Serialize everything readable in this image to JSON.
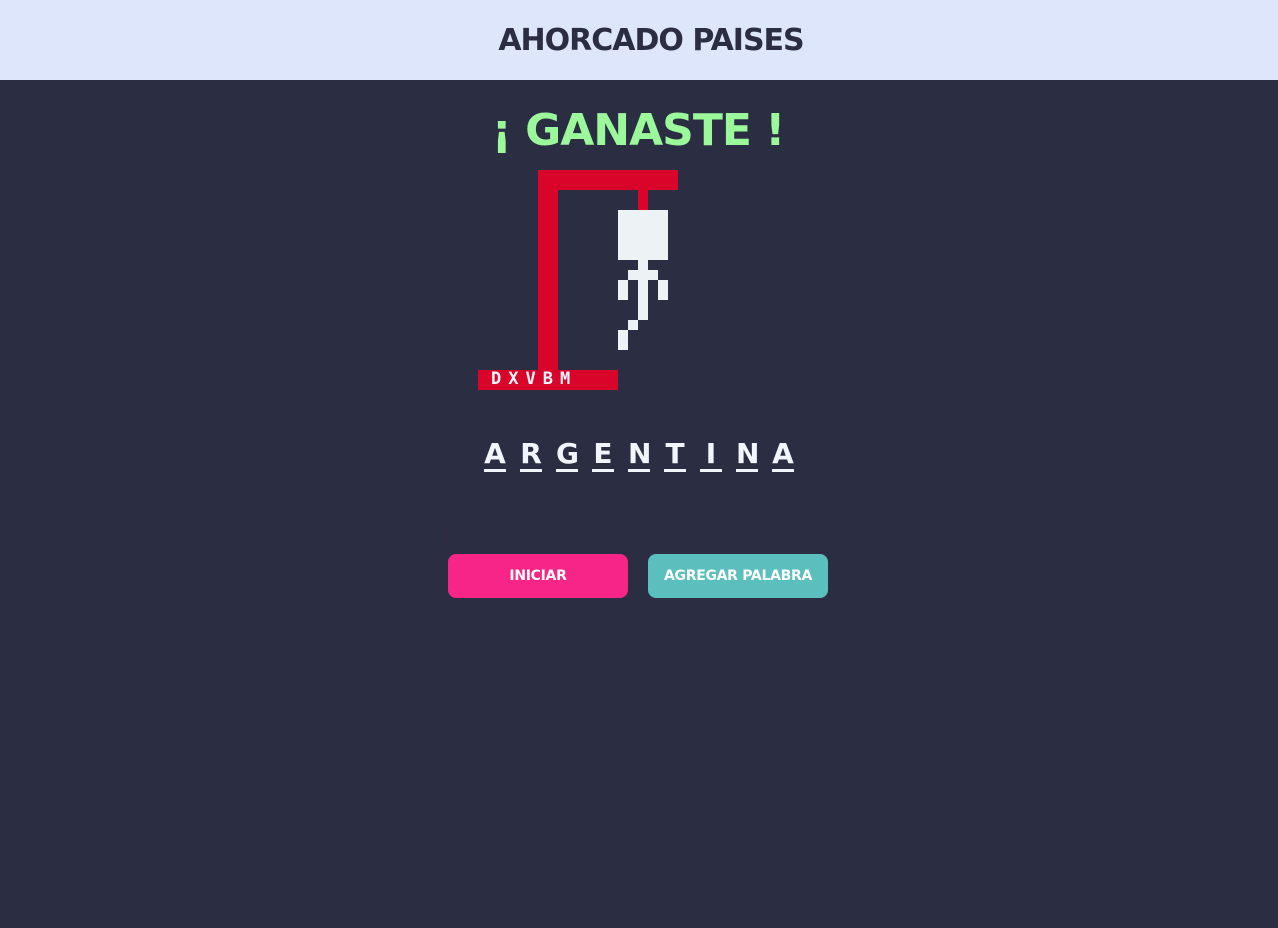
{
  "header": {
    "title": "AHORCADO PAISES"
  },
  "game": {
    "status": "¡ GANASTE !",
    "wrong_letters": [
      "D",
      "X",
      "V",
      "B",
      "M"
    ],
    "word": [
      "A",
      "R",
      "G",
      "E",
      "N",
      "T",
      "I",
      "N",
      "A"
    ]
  },
  "buttons": {
    "start_label": "INICIAR",
    "add_word_label": "AGREGAR PALABRA"
  },
  "colors": {
    "background": "#2b2d42",
    "header_bg": "#dee6fb",
    "status_win": "#9bf89b",
    "gallows": "#d90429",
    "figure": "#edf2f4",
    "start_button": "#f72585",
    "add_button": "#5bbfbd"
  }
}
